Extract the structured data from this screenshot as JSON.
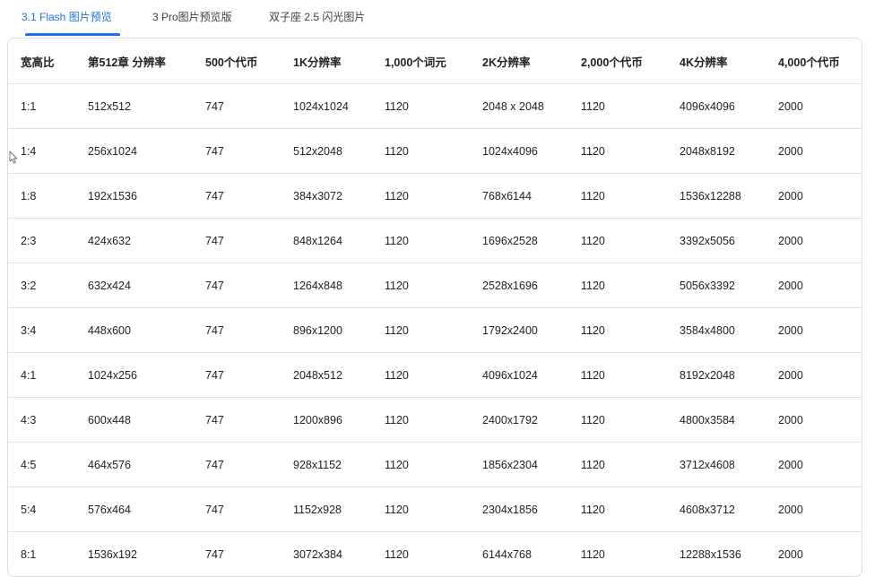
{
  "tabs": [
    {
      "label": "3.1 Flash 图片预览",
      "active": true
    },
    {
      "label": "3 Pro图片预览版",
      "active": false
    },
    {
      "label": "双子座 2.5 闪光图片",
      "active": false
    }
  ],
  "table": {
    "columns": [
      "宽高比",
      "第512章 分辨率",
      "500个代币",
      "1K分辨率",
      "1,000个词元",
      "2K分辨率",
      "2,000个代币",
      "4K分辨率",
      "4,000个代币"
    ],
    "rows": [
      [
        "1:1",
        "512x512",
        "747",
        "1024x1024",
        "1120",
        "2048 x 2048",
        "1120",
        "4096x4096",
        "2000"
      ],
      [
        "1:4",
        "256x1024",
        "747",
        "512x2048",
        "1120",
        "1024x4096",
        "1120",
        "2048x8192",
        "2000"
      ],
      [
        "1:8",
        "192x1536",
        "747",
        "384x3072",
        "1120",
        "768x6144",
        "1120",
        "1536x12288",
        "2000"
      ],
      [
        "2:3",
        "424x632",
        "747",
        "848x1264",
        "1120",
        "1696x2528",
        "1120",
        "3392x5056",
        "2000"
      ],
      [
        "3:2",
        "632x424",
        "747",
        "1264x848",
        "1120",
        "2528x1696",
        "1120",
        "5056x3392",
        "2000"
      ],
      [
        "3:4",
        "448x600",
        "747",
        "896x1200",
        "1120",
        "1792x2400",
        "1120",
        "3584x4800",
        "2000"
      ],
      [
        "4:1",
        "1024x256",
        "747",
        "2048x512",
        "1120",
        "4096x1024",
        "1120",
        "8192x2048",
        "2000"
      ],
      [
        "4:3",
        "600x448",
        "747",
        "1200x896",
        "1120",
        "2400x1792",
        "1120",
        "4800x3584",
        "2000"
      ],
      [
        "4:5",
        "464x576",
        "747",
        "928x1152",
        "1120",
        "1856x2304",
        "1120",
        "3712x4608",
        "2000"
      ],
      [
        "5:4",
        "576x464",
        "747",
        "1152x928",
        "1120",
        "2304x1856",
        "1120",
        "4608x3712",
        "2000"
      ],
      [
        "8:1",
        "1536x192",
        "747",
        "3072x384",
        "1120",
        "6144x768",
        "1120",
        "12288x1536",
        "2000"
      ]
    ]
  },
  "colors": {
    "accent": "#1a73e8",
    "border": "#e0e0e0",
    "text": "#202124"
  }
}
